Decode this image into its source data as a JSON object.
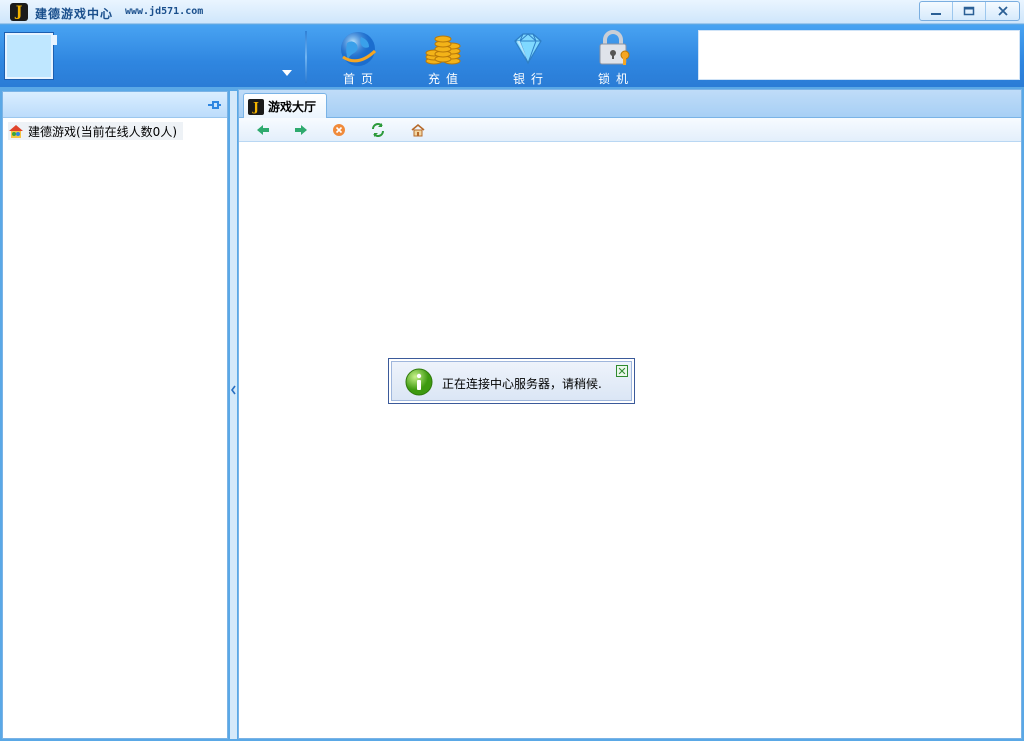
{
  "window": {
    "title": "建德游戏中心",
    "url": "www.jd571.com",
    "logo_letter": "J"
  },
  "toolbar": {
    "nav": [
      {
        "label": "首页",
        "icon": "globe-icon"
      },
      {
        "label": "充值",
        "icon": "coins-icon"
      },
      {
        "label": "银行",
        "icon": "diamond-icon"
      },
      {
        "label": "锁机",
        "icon": "lock-icon"
      }
    ]
  },
  "sidebar": {
    "tree": [
      {
        "label": "建德游戏(当前在线人数0人)",
        "icon": "game-house-icon"
      }
    ]
  },
  "content": {
    "tab_label": "游戏大厅",
    "tab_logo": "J",
    "browser_buttons": [
      "back-icon",
      "forward-icon",
      "stop-icon",
      "refresh-icon",
      "home-icon"
    ]
  },
  "notice": {
    "message": "正在连接中心服务器，请稍候.",
    "icon": "info-icon"
  },
  "colors": {
    "toolbar_blue": "#2f86e0",
    "title_text": "#1a4f8c",
    "panel_border": "#7ab3e6"
  }
}
